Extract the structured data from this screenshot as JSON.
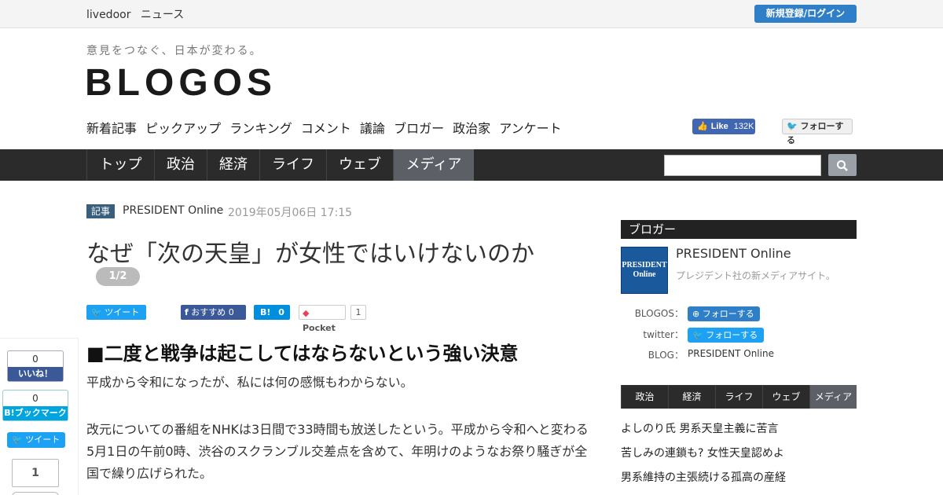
{
  "topbar": {
    "brand_a": "livedoor",
    "brand_b": "ニュース",
    "login": "新規登録/ログイン"
  },
  "header": {
    "tagline": "意見をつなぐ、日本が変わる。",
    "logo": "BLOGOS",
    "subnav": [
      "新着記事",
      "ピックアップ",
      "ランキング",
      "コメント",
      "議論",
      "ブロガー",
      "政治家",
      "アンケート"
    ],
    "fb_like_label": "Like",
    "fb_like_count": "132K",
    "tw_follow": "フォローする"
  },
  "mainnav": {
    "items": [
      "トップ",
      "政治",
      "経済",
      "ライフ",
      "ウェブ",
      "メディア"
    ],
    "active": "メディア"
  },
  "article": {
    "category": "記事",
    "source": "PRESIDENT Online",
    "date": "2019年05月06日 17:15",
    "title": "なぜ「次の天皇」が女性ではいけないのか",
    "page": "1/2",
    "share": {
      "tweet": "ツイート",
      "fb": "おすすめ",
      "fb_count": "0",
      "hatena": "B!",
      "hatena_count": "0",
      "pocket": "Pocket",
      "pocket_count": "1"
    },
    "heading": "■二度と戦争は起こしてはならないという強い決意",
    "paragraphs": [
      "平成から令和になったが、私には何の感慨もわからない。",
      "改元についての番組をNHKは3日間で33時間も放送したという。平成から令和へと変わる5月1日の午前0時、渋谷のスクランブル交差点を含めて、年明けのようなお祭り騒ぎが全国で繰り広げられた。"
    ]
  },
  "side_share": {
    "fb_count": "0",
    "fb_label": "いいね！",
    "hb_count": "0",
    "hb_label": "B!ブックマーク",
    "tweet": "ツイート",
    "pocket_count": "1"
  },
  "sidebar": {
    "heading": "ブロガー",
    "blogger_name": "PRESIDENT Online",
    "blogger_logo_a": "PRESIDENT",
    "blogger_logo_b": "Online",
    "blogger_desc": "プレジデント社の新メディアサイト。",
    "labels": {
      "blogos": "BLOGOS：",
      "twitter": "twitter：",
      "blog": "BLOG："
    },
    "follow_blogos": "フォローする",
    "follow_twitter": "フォローする",
    "blog_name": "PRESIDENT Online",
    "tabs": [
      "政治",
      "経済",
      "ライフ",
      "ウェブ",
      "メディア"
    ],
    "active_tab": "メディア",
    "links": [
      "よしのり氏 男系天皇主義に苦言",
      "苦しみの連鎖も? 女性天皇認めよ",
      "男系維持の主張続ける孤高の産経"
    ]
  },
  "colors": {
    "accent_blue": "#2f7fc8",
    "nav_dark": "#2b2b2b",
    "nav_active": "#5c5f66"
  }
}
